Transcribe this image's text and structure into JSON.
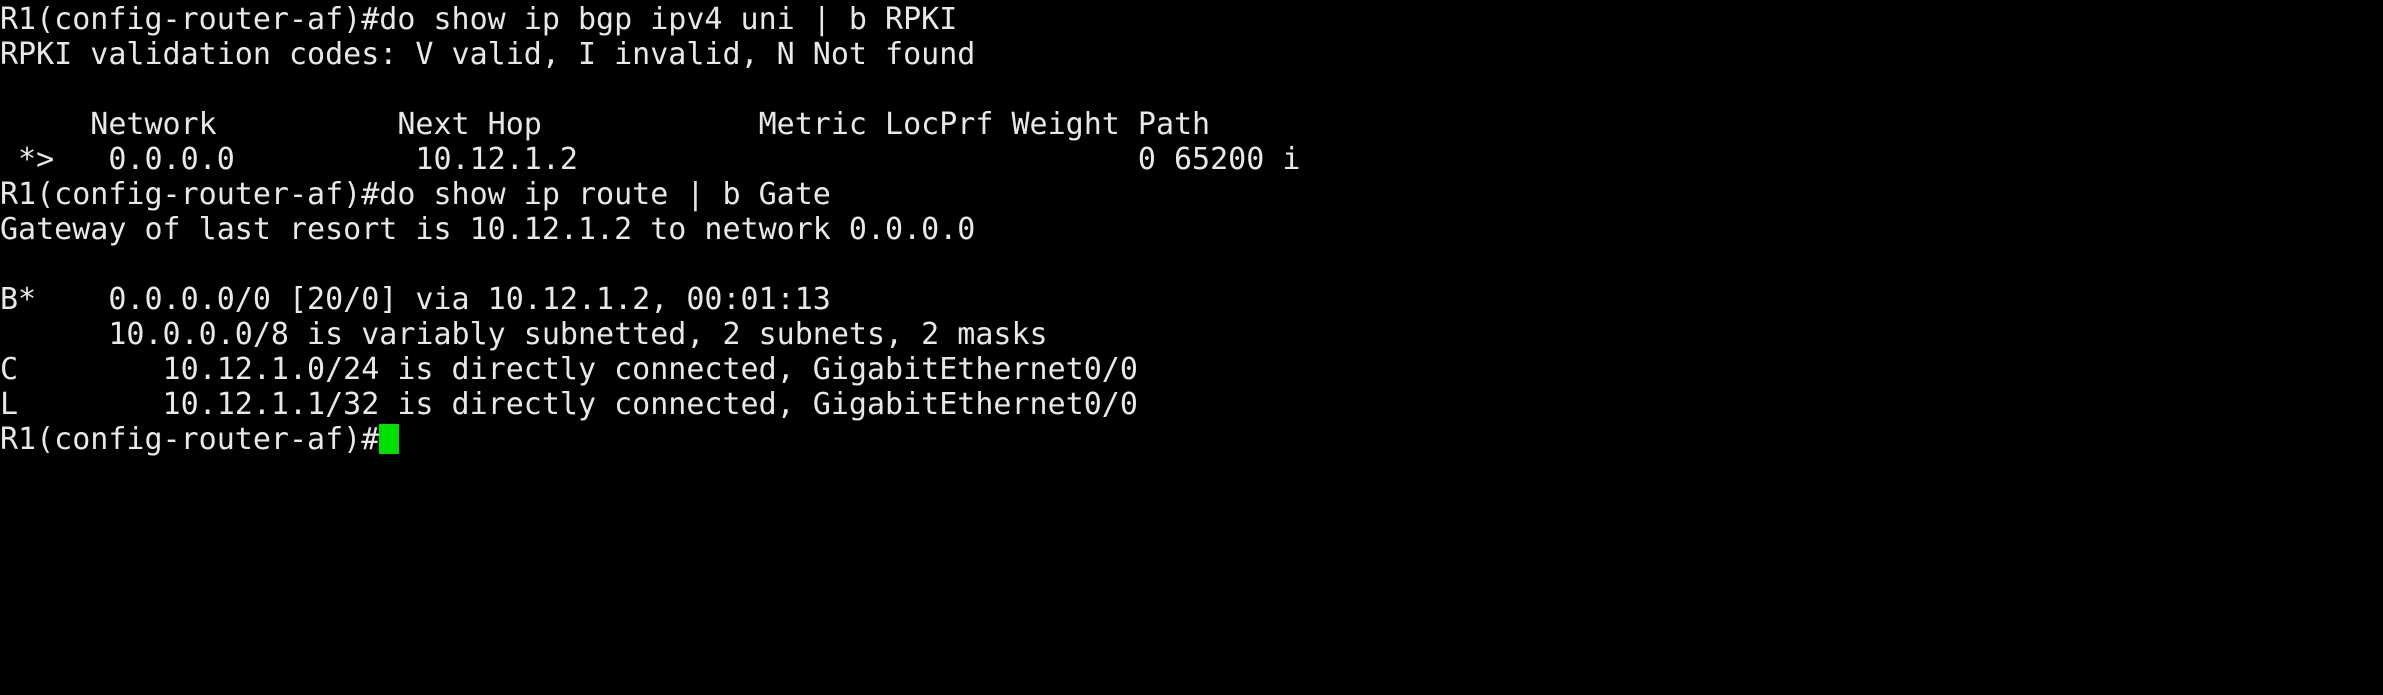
{
  "terminal": {
    "device_prompt": "R1(config-router-af)#",
    "colors": {
      "background": "#000000",
      "foreground": "#e8e8e8",
      "cursor": "#00e000"
    },
    "lines": [
      {
        "id": "cmd-show-bgp",
        "text": "R1(config-router-af)#do show ip bgp ipv4 uni | b RPKI"
      },
      {
        "id": "rpki-validation-codes",
        "text": "RPKI validation codes: V valid, I invalid, N Not found"
      },
      {
        "id": "blank-1",
        "text": " "
      },
      {
        "id": "bgp-table-header",
        "text": "     Network          Next Hop            Metric LocPrf Weight Path"
      },
      {
        "id": "bgp-route-default",
        "text": " *>   0.0.0.0          10.12.1.2                               0 65200 i"
      },
      {
        "id": "cmd-show-ip-route",
        "text": "R1(config-router-af)#do show ip route | b Gate"
      },
      {
        "id": "gateway-of-last-resort",
        "text": "Gateway of last resort is 10.12.1.2 to network 0.0.0.0"
      },
      {
        "id": "blank-2",
        "text": " "
      },
      {
        "id": "route-bgp-default",
        "text": "B*    0.0.0.0/0 [20/0] via 10.12.1.2, 00:01:13"
      },
      {
        "id": "route-subnetted-header",
        "text": "      10.0.0.0/8 is variably subnetted, 2 subnets, 2 masks"
      },
      {
        "id": "route-connected-c",
        "text": "C        10.12.1.0/24 is directly connected, GigabitEthernet0/0"
      },
      {
        "id": "route-connected-l",
        "text": "L        10.12.1.1/32 is directly connected, GigabitEthernet0/0"
      }
    ],
    "prompt_line": {
      "text": "R1(config-router-af)#",
      "cursor_visible": true
    },
    "bgp_table": {
      "rpki_codes_label": "RPKI validation codes: V valid, I invalid, N Not found",
      "columns": [
        "Network",
        "Next Hop",
        "Metric",
        "LocPrf",
        "Weight",
        "Path"
      ],
      "rows": [
        {
          "status": "*>",
          "network": "0.0.0.0",
          "next_hop": "10.12.1.2",
          "metric": "",
          "locprf": "",
          "weight": "0",
          "path": "65200 i"
        }
      ]
    },
    "ip_route_table": {
      "gateway_of_last_resort": "10.12.1.2",
      "gateway_network": "0.0.0.0",
      "entries": [
        {
          "code": "B*",
          "prefix": "0.0.0.0/0",
          "admin_metric": "[20/0]",
          "via": "10.12.1.2",
          "uptime": "00:01:13",
          "interface": ""
        },
        {
          "code": "",
          "prefix": "10.0.0.0/8",
          "admin_metric": "",
          "via": "",
          "uptime": "",
          "interface": "is variably subnetted, 2 subnets, 2 masks"
        },
        {
          "code": "C",
          "prefix": "10.12.1.0/24",
          "admin_metric": "",
          "via": "",
          "uptime": "",
          "interface": "GigabitEthernet0/0"
        },
        {
          "code": "L",
          "prefix": "10.12.1.1/32",
          "admin_metric": "",
          "via": "",
          "uptime": "",
          "interface": "GigabitEthernet0/0"
        }
      ]
    },
    "commands": [
      "do show ip bgp ipv4 uni | b RPKI",
      "do show ip route | b Gate"
    ]
  }
}
